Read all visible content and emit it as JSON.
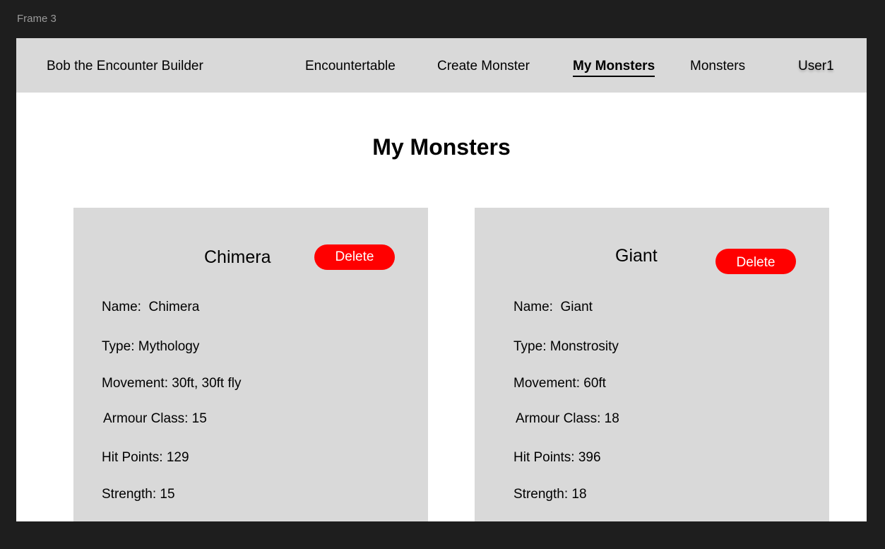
{
  "editor": {
    "frame_label": "Frame 3"
  },
  "nav": {
    "brand": "Bob the Encounter Builder",
    "links": [
      "Encountertable",
      "Create Monster",
      "My Monsters",
      "Monsters"
    ],
    "active": "My Monsters",
    "user": "User1"
  },
  "page": {
    "title": "My Monsters"
  },
  "monsters": [
    {
      "title": "Chimera",
      "delete_label": "Delete",
      "name": "Name:  Chimera",
      "type": "Type: Mythology",
      "movement": "Movement: 30ft, 30ft fly",
      "armour_class": "Armour Class: 15",
      "hit_points": "Hit Points: 129",
      "strength": "Strength: 15"
    },
    {
      "title": "Giant",
      "delete_label": "Delete",
      "name": "Name:  Giant",
      "type": "Type: Monstrosity",
      "movement": "Movement: 60ft",
      "armour_class": "Armour Class: 18",
      "hit_points": "Hit Points: 396",
      "strength": "Strength: 18"
    }
  ],
  "colors": {
    "delete": "#ff0000",
    "card_bg": "#d9d9d9",
    "nav_bg": "#d9d9d9",
    "editor_bg": "#1e1e1e"
  }
}
